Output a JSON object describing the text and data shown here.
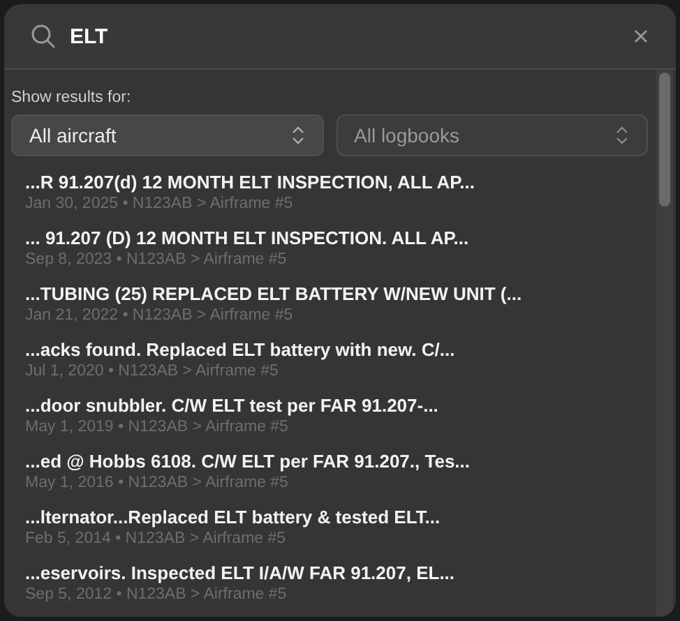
{
  "search": {
    "value": "ELT"
  },
  "filter_label": "Show results for:",
  "filters": [
    {
      "label": "All aircraft",
      "disabled": false
    },
    {
      "label": "All logbooks",
      "disabled": true
    }
  ],
  "results": [
    {
      "title": "...R 91.207(d) 12 MONTH ELT INSPECTION, ALL AP...",
      "meta": "Jan 30, 2025 • N123AB > Airframe #5"
    },
    {
      "title": "... 91.207 (D) 12 MONTH ELT INSPECTION. ALL AP...",
      "meta": "Sep 8, 2023 • N123AB > Airframe #5"
    },
    {
      "title": "...TUBING (25) REPLACED ELT BATTERY W/NEW UNIT (...",
      "meta": "Jan 21, 2022 • N123AB > Airframe #5"
    },
    {
      "title": "...acks found. Replaced ELT battery with new. C/...",
      "meta": "Jul 1, 2020 • N123AB > Airframe #5"
    },
    {
      "title": "...door snubbler. C/W ELT test per FAR 91.207-...",
      "meta": "May 1, 2019 • N123AB > Airframe #5"
    },
    {
      "title": "...ed @ Hobbs 6108. C/W ELT per FAR 91.207., Tes...",
      "meta": "May 1, 2016 • N123AB > Airframe #5"
    },
    {
      "title": "...lternator...Replaced ELT battery & tested ELT...",
      "meta": "Feb 5, 2014 • N123AB > Airframe #5"
    },
    {
      "title": "...eservoirs. Inspected ELT I/A/W FAR 91.207, EL...",
      "meta": "Sep 5, 2012 • N123AB > Airframe #5"
    }
  ]
}
